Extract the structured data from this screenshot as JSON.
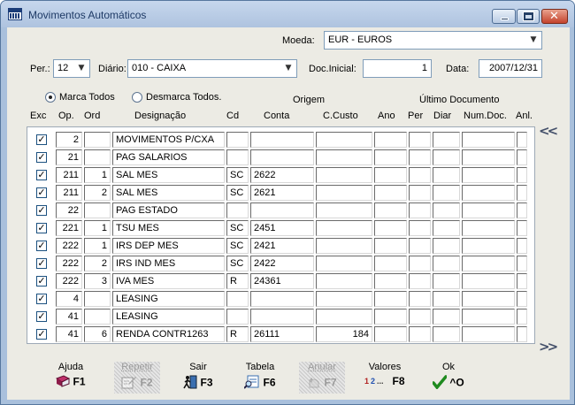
{
  "window": {
    "title": "Movimentos Automáticos"
  },
  "form": {
    "moeda_label": "Moeda:",
    "moeda_value": "EUR - EUROS",
    "per_label": "Per.:",
    "per_value": "12",
    "diario_label": "Diário:",
    "diario_value": "010 - CAIXA",
    "doc_inicial_label": "Doc.Inicial:",
    "doc_inicial_value": "1",
    "data_label": "Data:",
    "data_value": "2007/12/31",
    "marca_todos": "Marca Todos",
    "desmarca_todos": "Desmarca Todos."
  },
  "table": {
    "group_headers": {
      "origem": "Origem",
      "ultimo_documento": "Último Documento"
    },
    "columns": {
      "exc": "Exc",
      "op": "Op.",
      "ord": "Ord",
      "designacao": "Designação",
      "cd": "Cd",
      "conta": "Conta",
      "ccusto": "C.Custo",
      "ano": "Ano",
      "per": "Per",
      "diar": "Diar",
      "numdoc": "Num.Doc.",
      "anl": "Anl."
    },
    "rows": [
      {
        "checked": true,
        "op": "2",
        "ord": "",
        "designacao": "MOVIMENTOS P/CXA",
        "cd": "",
        "conta": "",
        "ccusto": ""
      },
      {
        "checked": true,
        "op": "21",
        "ord": "",
        "designacao": "PAG SALARIOS",
        "cd": "",
        "conta": "",
        "ccusto": ""
      },
      {
        "checked": true,
        "op": "211",
        "ord": "1",
        "designacao": "SAL MES",
        "cd": "SC",
        "conta": "2622",
        "ccusto": ""
      },
      {
        "checked": true,
        "op": "211",
        "ord": "2",
        "designacao": "SAL MES",
        "cd": "SC",
        "conta": "2621",
        "ccusto": ""
      },
      {
        "checked": true,
        "op": "22",
        "ord": "",
        "designacao": "PAG ESTADO",
        "cd": "",
        "conta": "",
        "ccusto": ""
      },
      {
        "checked": true,
        "op": "221",
        "ord": "1",
        "designacao": "TSU MES",
        "cd": "SC",
        "conta": "2451",
        "ccusto": ""
      },
      {
        "checked": true,
        "op": "222",
        "ord": "1",
        "designacao": "IRS DEP MES",
        "cd": "SC",
        "conta": "2421",
        "ccusto": ""
      },
      {
        "checked": true,
        "op": "222",
        "ord": "2",
        "designacao": "IRS IND MES",
        "cd": "SC",
        "conta": "2422",
        "ccusto": ""
      },
      {
        "checked": true,
        "op": "222",
        "ord": "3",
        "designacao": "IVA MES",
        "cd": "R",
        "conta": "24361",
        "ccusto": ""
      },
      {
        "checked": true,
        "op": "4",
        "ord": "",
        "designacao": "LEASING",
        "cd": "",
        "conta": "",
        "ccusto": ""
      },
      {
        "checked": true,
        "op": "41",
        "ord": "",
        "designacao": "LEASING",
        "cd": "",
        "conta": "",
        "ccusto": ""
      },
      {
        "checked": true,
        "op": "41",
        "ord": "6",
        "designacao": "RENDA CONTR1263",
        "cd": "R",
        "conta": "26111",
        "ccusto": "184"
      }
    ],
    "nav_up": "<<",
    "nav_down": ">>"
  },
  "fkeys": [
    {
      "name": "Ajuda",
      "key": "F1",
      "icon": "book-icon",
      "enabled": true
    },
    {
      "name": "Repetir",
      "key": "F2",
      "icon": "edit-icon",
      "enabled": false
    },
    {
      "name": "Sair",
      "key": "F3",
      "icon": "exit-door-icon",
      "enabled": true
    },
    {
      "name": "Tabela",
      "key": "F6",
      "icon": "table-search-icon",
      "enabled": true
    },
    {
      "name": "Anular",
      "key": "F7",
      "icon": "undo-icon",
      "enabled": false
    },
    {
      "name": "Valores",
      "key": "F8",
      "icon": "numbers-icon",
      "enabled": true
    },
    {
      "name": "Ok",
      "key": "^O",
      "icon": "checkmark-icon",
      "enabled": true
    }
  ],
  "colors": {
    "titlebar": "#b6cae4",
    "client": "#ecebe4",
    "check_green": "#1f8a1f"
  }
}
